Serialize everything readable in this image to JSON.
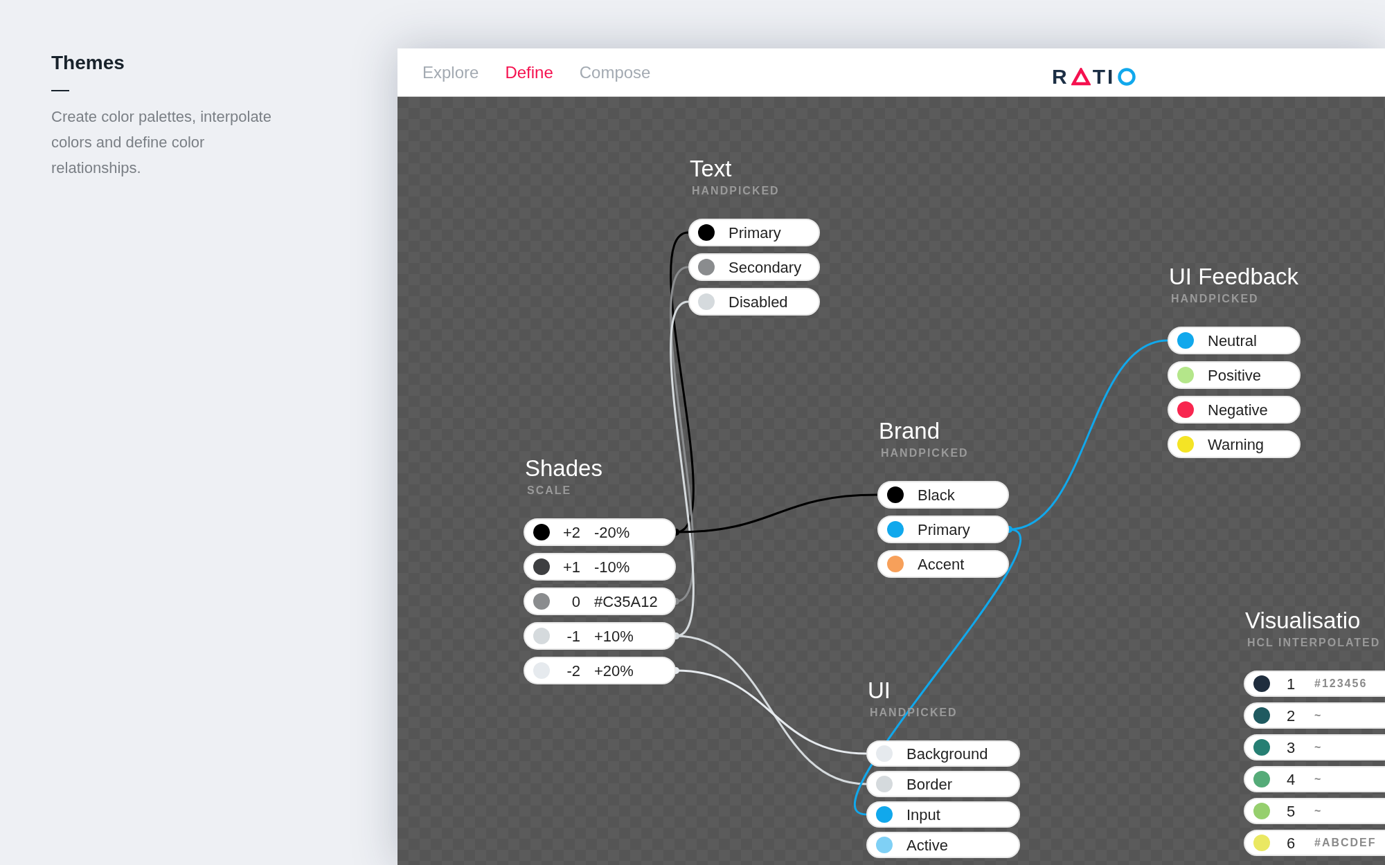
{
  "intro": {
    "title": "Themes",
    "description": "Create color palettes, interpolate colors and define color relationships."
  },
  "nav": {
    "tabs": [
      {
        "label": "Explore",
        "selected": false
      },
      {
        "label": "Define",
        "selected": true
      },
      {
        "label": "Compose",
        "selected": false
      }
    ],
    "logo_parts": [
      "R",
      "TI"
    ]
  },
  "groups": [
    {
      "title": "Text",
      "subtitle": "HANDPICKED",
      "rows": [
        {
          "kind": "label",
          "label": "Primary",
          "color": "#000000"
        },
        {
          "kind": "label",
          "label": "Secondary",
          "color": "#8a8c8e"
        },
        {
          "kind": "label",
          "label": "Disabled",
          "color": "#d5dadd"
        }
      ]
    },
    {
      "title": "Shades",
      "subtitle": "SCALE",
      "rows": [
        {
          "kind": "step",
          "step": "+2",
          "value": "-20%",
          "color": "#000000"
        },
        {
          "kind": "step",
          "step": "+1",
          "value": "-10%",
          "color": "#3e3f41"
        },
        {
          "kind": "step",
          "step": "0",
          "value": "#C35A12",
          "color": "#8a8c8e"
        },
        {
          "kind": "step",
          "step": "-1",
          "value": "+10%",
          "color": "#d5dadd"
        },
        {
          "kind": "step",
          "step": "-2",
          "value": "+20%",
          "color": "#e6eaee"
        }
      ]
    },
    {
      "title": "Brand",
      "subtitle": "HANDPICKED",
      "rows": [
        {
          "kind": "label",
          "label": "Black",
          "color": "#000000"
        },
        {
          "kind": "label",
          "label": "Primary",
          "color": "#11a8ec"
        },
        {
          "kind": "label",
          "label": "Accent",
          "color": "#f7a05a"
        }
      ]
    },
    {
      "title": "UI Feedback",
      "subtitle": "HANDPICKED",
      "rows": [
        {
          "kind": "label",
          "label": "Neutral",
          "color": "#11a8ec"
        },
        {
          "kind": "label",
          "label": "Positive",
          "color": "#b4e68a"
        },
        {
          "kind": "label",
          "label": "Negative",
          "color": "#f8264f"
        },
        {
          "kind": "label",
          "label": "Warning",
          "color": "#f4e425"
        }
      ]
    },
    {
      "title": "UI",
      "subtitle": "HANDPICKED",
      "rows": [
        {
          "kind": "label",
          "label": "Background",
          "color": "#e6eaee"
        },
        {
          "kind": "label",
          "label": "Border",
          "color": "#d5dadd"
        },
        {
          "kind": "label",
          "label": "Input",
          "color": "#11a8ec"
        },
        {
          "kind": "label",
          "label": "Active",
          "color": "#7fd0f5"
        }
      ]
    },
    {
      "title": "Visualisatio",
      "subtitle": "HCL INTERPOLATED",
      "rows": [
        {
          "kind": "interp",
          "step": "1",
          "value": "#123456",
          "color": "#1f2d3d"
        },
        {
          "kind": "interp",
          "step": "2",
          "value": "~",
          "color": "#1f5a60"
        },
        {
          "kind": "interp",
          "step": "3",
          "value": "~",
          "color": "#267f73"
        },
        {
          "kind": "interp",
          "step": "4",
          "value": "~",
          "color": "#55ab78"
        },
        {
          "kind": "interp",
          "step": "5",
          "value": "~",
          "color": "#96cf6e"
        },
        {
          "kind": "interp",
          "step": "6",
          "value": "#ABCDEF",
          "color": "#eae862"
        }
      ]
    }
  ]
}
